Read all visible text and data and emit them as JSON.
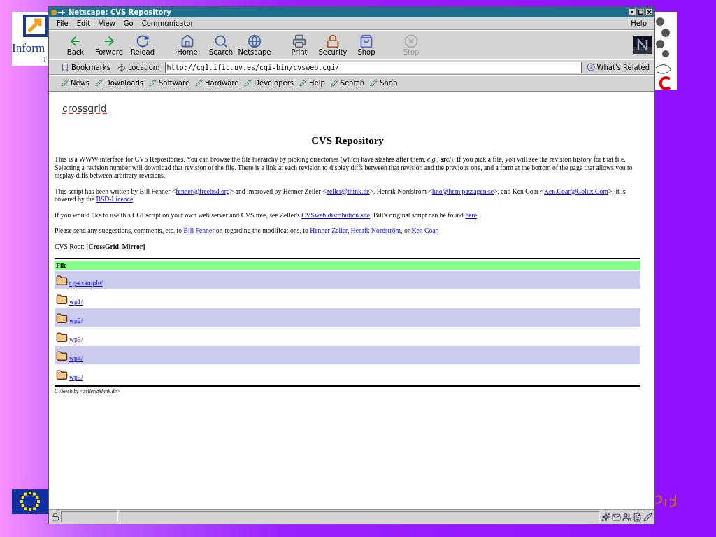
{
  "slide": {
    "left_logo_text": "Inform",
    "left_logo_subtext": "T"
  },
  "window": {
    "title": "Netscape: CVS Repository"
  },
  "menu": [
    {
      "label": "File"
    },
    {
      "label": "Edit"
    },
    {
      "label": "View"
    },
    {
      "label": "Go"
    },
    {
      "label": "Communicator"
    }
  ],
  "help_menu": "Help",
  "toolbar": [
    {
      "label": "Back",
      "disabled": false
    },
    {
      "label": "Forward",
      "disabled": false
    },
    {
      "label": "Reload",
      "disabled": false
    },
    {
      "label": "Home",
      "disabled": false
    },
    {
      "label": "Search",
      "disabled": false
    },
    {
      "label": "Netscape",
      "disabled": false
    },
    {
      "label": "Print",
      "disabled": false
    },
    {
      "label": "Security",
      "disabled": false
    },
    {
      "label": "Shop",
      "disabled": false
    },
    {
      "label": "Stop",
      "disabled": true
    }
  ],
  "location_bar": {
    "bookmarks": "Bookmarks",
    "location_label": "Location:",
    "url": "http://cg1.ific.uv.es/cgi-bin/cvsweb.cgi/",
    "whats_related": "What's Related"
  },
  "personal_toolbar": [
    "News",
    "Downloads",
    "Software",
    "Hardware",
    "Developers",
    "Help",
    "Search",
    "Shop"
  ],
  "page": {
    "logo": "crossgrid",
    "heading": "CVS Repository",
    "paragraphs": [
      [
        {
          "text": "This is a WWW interface for CVS Repositories. You can browse the file hierarchy by picking directories (which have slashes after them, *e.g.*, **src/**). If you pick a file, you will see the revision history for that file. Selecting a revision number will download that revision of the file. There is a link at each revision to display diffs between that revision and the previous one, and a form at the bottom of the page that allows you to display diffs between arbitrary revisions."
        }
      ],
      [
        {
          "text": "This script has been written by Bill Fenner <"
        },
        {
          "link": "fenner@freebsd.org"
        },
        {
          "text": "> and improved by Henner Zeller <"
        },
        {
          "link": "zeller@think.de"
        },
        {
          "text": ">, Henrik Nordström <"
        },
        {
          "link": "hno@hem.passagen.se"
        },
        {
          "text": ">, and Ken Coar <"
        },
        {
          "link": "Ken.Coar@Golux.Com"
        },
        {
          "text": ">; it is covered by the "
        },
        {
          "link": "BSD-Licence"
        },
        {
          "text": "."
        }
      ],
      [
        {
          "text": "If you would like to use this CGI script on your own web server and CVS tree, see Zeller's "
        },
        {
          "link": "CVSweb distribution site"
        },
        {
          "text": ". Bill's original script can be found "
        },
        {
          "link": "here"
        },
        {
          "text": "."
        }
      ],
      [
        {
          "text": "Please send any suggestions, comments, etc. to "
        },
        {
          "link": "Bill Fenner"
        },
        {
          "text": " or, regarding the modifications, to "
        },
        {
          "link": "Henner Zeller"
        },
        {
          "text": ", "
        },
        {
          "link": "Henrik Nordström"
        },
        {
          "text": ", or "
        },
        {
          "link": "Ken Coar"
        },
        {
          "text": "."
        }
      ],
      [
        {
          "text": "CVS Root: **[CrossGrid_Mirror]**"
        }
      ]
    ],
    "table": {
      "columns": [
        "File"
      ],
      "rows": [
        {
          "name": "cg-example/",
          "visited": false
        },
        {
          "name": "wp1/",
          "visited": false
        },
        {
          "name": "wp2/",
          "visited": false
        },
        {
          "name": "wp3/",
          "visited": true
        },
        {
          "name": "wp4/",
          "visited": false
        },
        {
          "name": "wp5/",
          "visited": false
        }
      ]
    },
    "footer": "CVSweb by <zeller@think.de>"
  }
}
